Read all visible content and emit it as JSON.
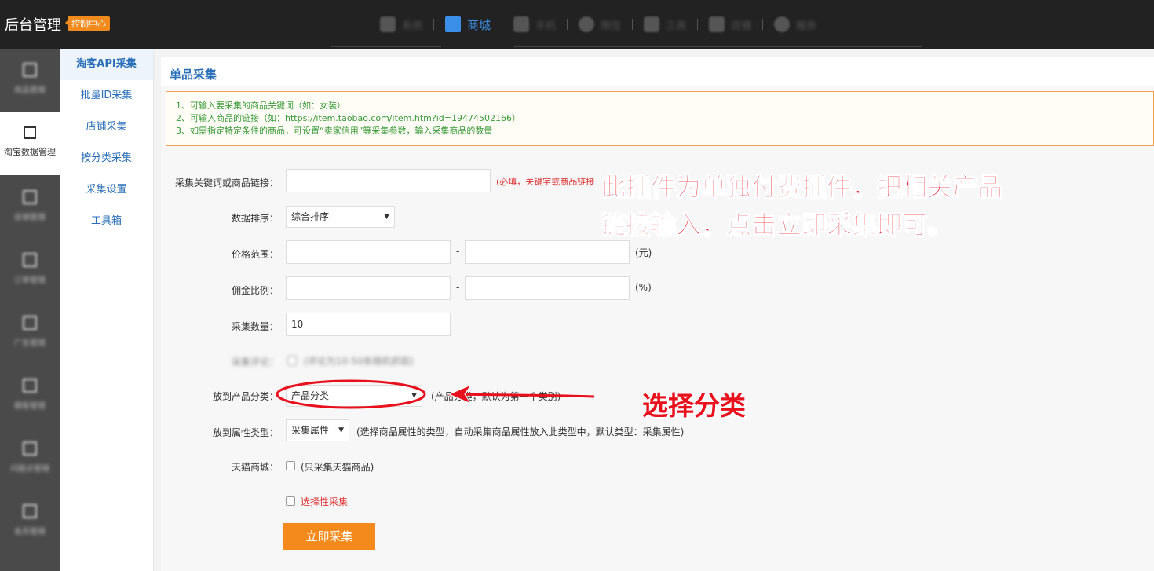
{
  "header": {
    "brand": "后台管理",
    "badge": "控制中心",
    "nav": [
      {
        "label": "系统",
        "icon": "grid-icon"
      },
      {
        "label": "商城",
        "icon": "picture-icon"
      },
      {
        "label": "手机",
        "icon": "monitor-icon"
      },
      {
        "label": "微信",
        "icon": "clock-icon"
      },
      {
        "label": "工具",
        "icon": "sitemap-icon"
      },
      {
        "label": "店铺",
        "icon": "shop-icon"
      },
      {
        "label": "服务",
        "icon": "cloud-icon"
      }
    ]
  },
  "sidebar": {
    "items": [
      {
        "label": "商品管理"
      },
      {
        "label": "淘宝数据管理"
      },
      {
        "label": "促销管理"
      },
      {
        "label": "订单管理"
      },
      {
        "label": "广告管理"
      },
      {
        "label": "模板管理"
      },
      {
        "label": "问题点管理"
      },
      {
        "label": "会员管理"
      }
    ]
  },
  "submenu": {
    "items": [
      "淘客API采集",
      "批量ID采集",
      "店铺采集",
      "按分类采集",
      "采集设置",
      "工具箱"
    ]
  },
  "panel": {
    "title": "单品采集",
    "notice": [
      "1、可输入要采集的商品关键词（如：女装）",
      "2、可输入商品的链接（如：https://item.taobao.com/item.htm?id=19474502166）",
      "3、如需指定特定条件的商品，可设置“卖家信用”等采集参数，输入采集商品的数量"
    ]
  },
  "form": {
    "keyword": {
      "label": "采集关键词或商品链接：",
      "value": "",
      "hint": "(必填，关键字或商品链接"
    },
    "sort": {
      "label": "数据排序：",
      "selected": "综合排序"
    },
    "price": {
      "label": "价格范围：",
      "sep": "-",
      "unit": "(元)"
    },
    "commission": {
      "label": "佣金比例：",
      "sep": "-",
      "unit": "(%)"
    },
    "count": {
      "label": "采集数量：",
      "value": "10"
    },
    "blurred": {
      "label": "采集评论：",
      "hint": "(评论为10-50条随机抓取)"
    },
    "category": {
      "label": "放到产品分类：",
      "selected": "产品分类",
      "hint": "(产品分类，默认为第一个类别)"
    },
    "attr_type": {
      "label": "放到属性类型：",
      "selected": "采集属性",
      "hint": "(选择商品属性的类型，自动采集商品属性放入此类型中，默认类型：采集属性)"
    },
    "tmall": {
      "label": "天猫商城：",
      "hint": "(只采集天猫商品)"
    },
    "selective": {
      "hint": "选择性采集"
    },
    "submit": "立即采集"
  },
  "annotations": {
    "main_line1": "此插件为单独付费插件，把相关产品",
    "main_line2": "链接输入，点击立即采集即可。",
    "category": "选择分类",
    "color": "#e8101c"
  }
}
